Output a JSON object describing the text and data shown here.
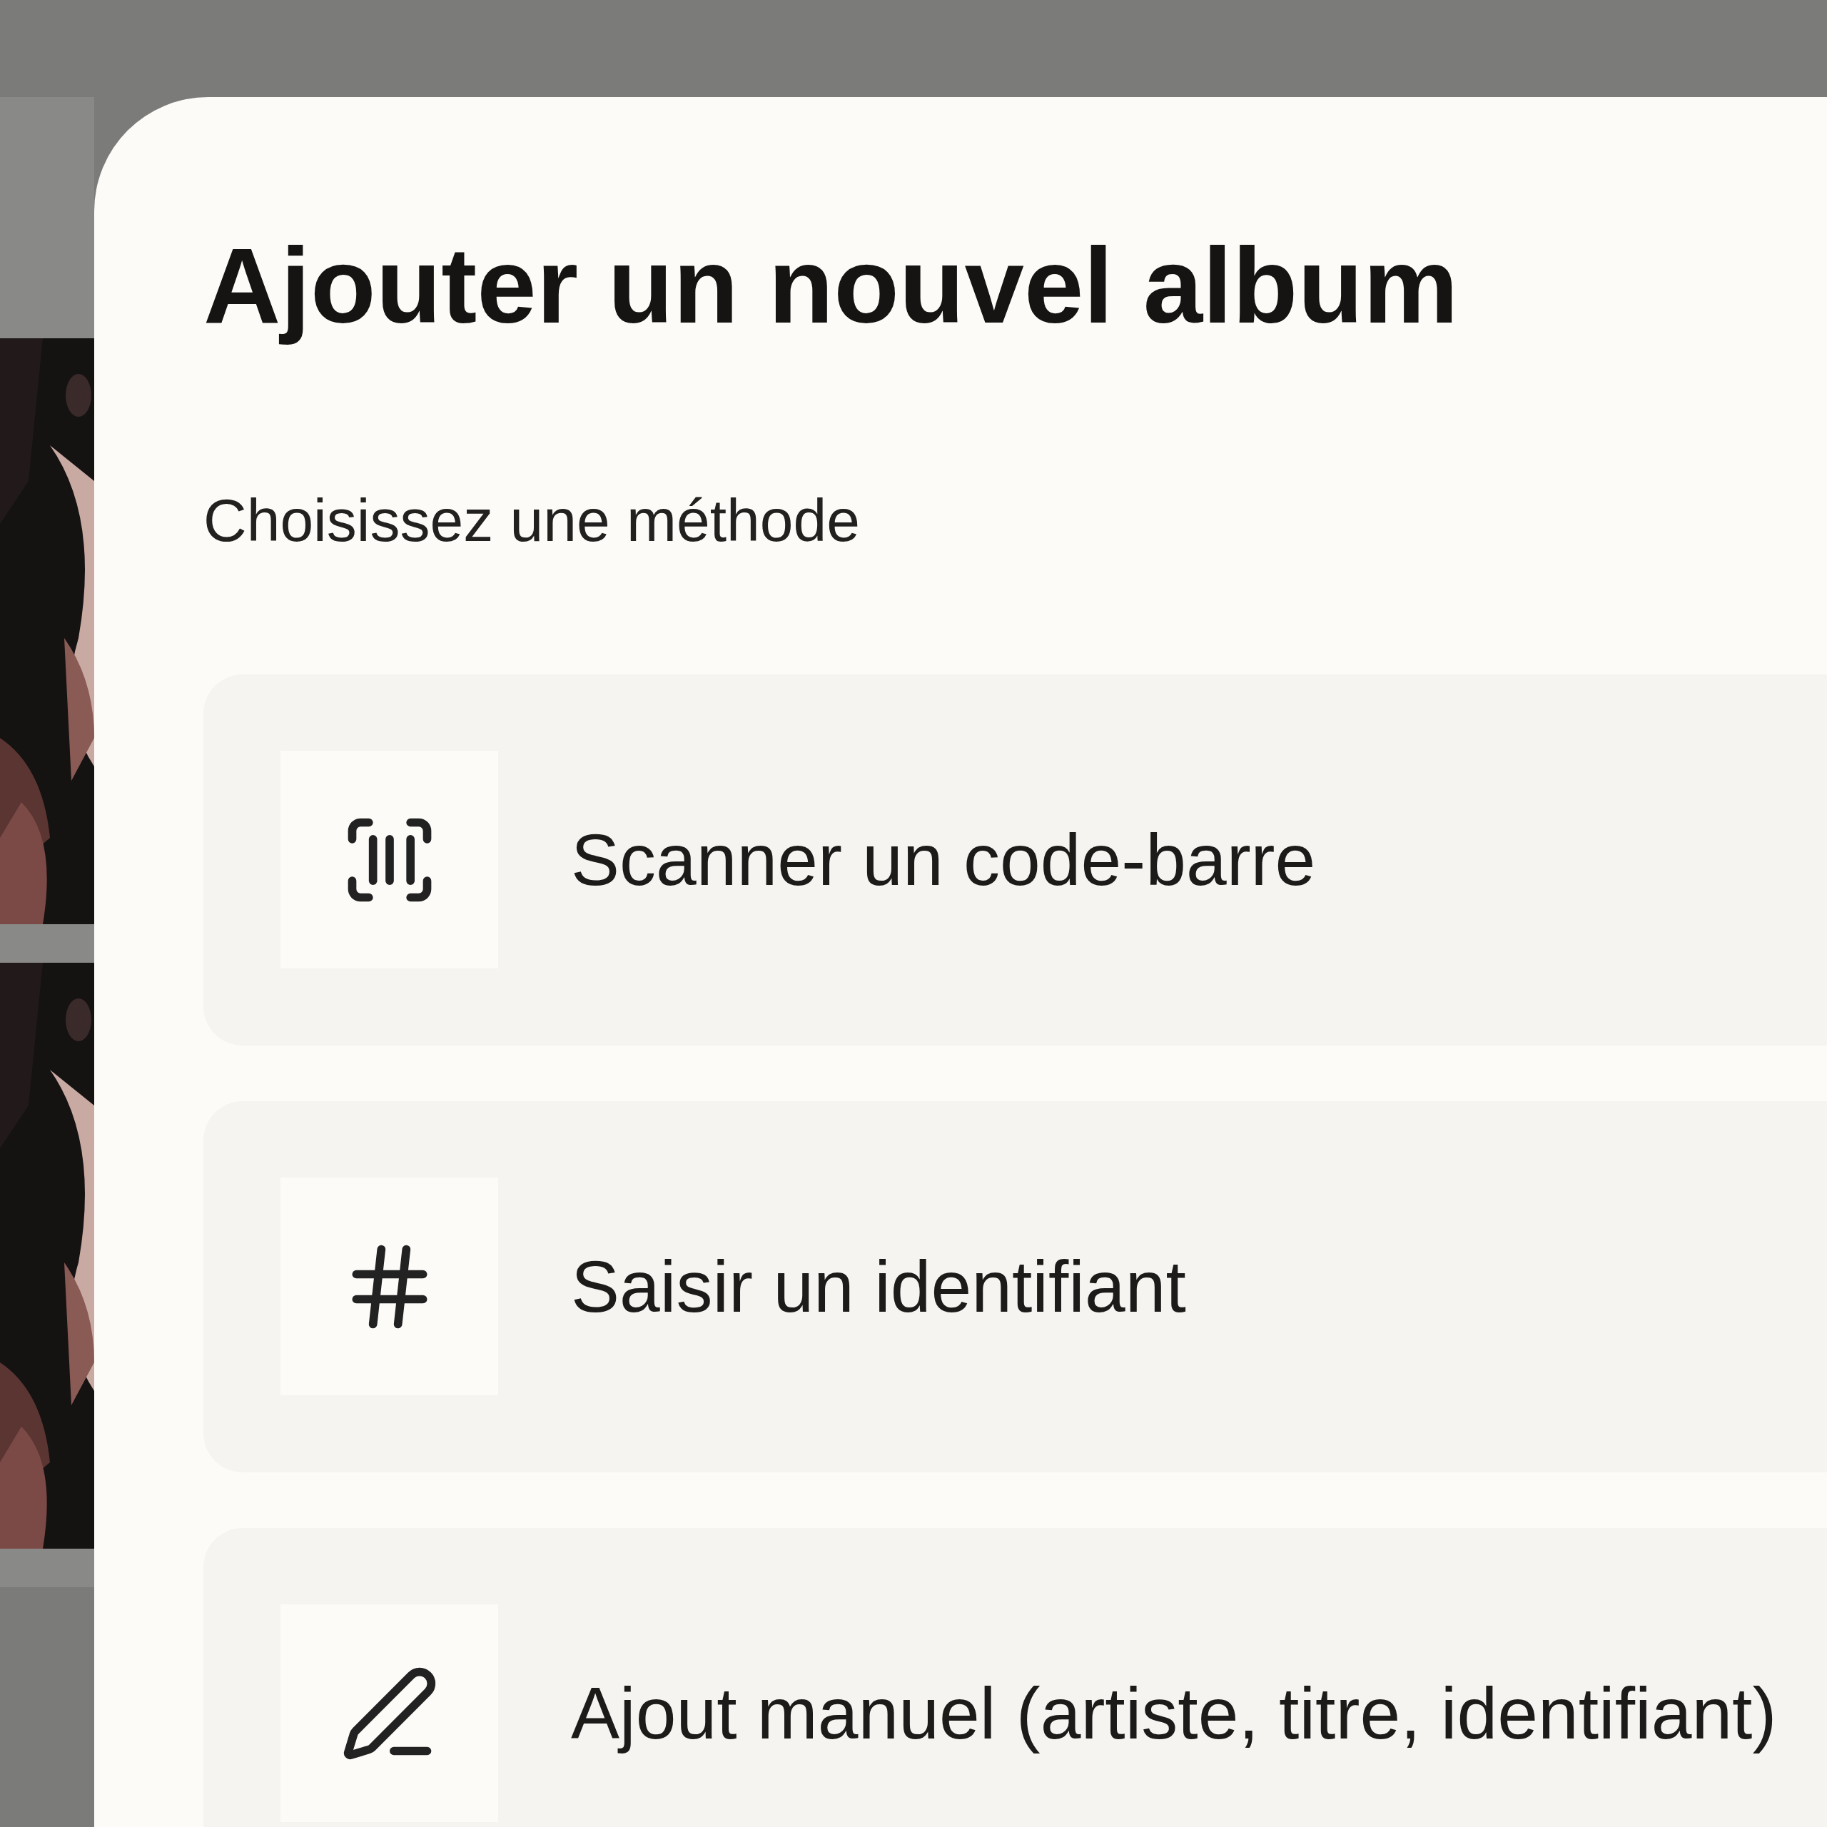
{
  "sheet": {
    "title": "Ajouter un nouvel album",
    "subtitle": "Choisissez une méthode",
    "methods": [
      {
        "kind": "barcode",
        "label": "Scanner un code-barre"
      },
      {
        "kind": "id",
        "label": "Saisir un identifiant"
      },
      {
        "kind": "manual",
        "label": "Ajout manuel (artiste, titre, identifiant)"
      }
    ]
  }
}
